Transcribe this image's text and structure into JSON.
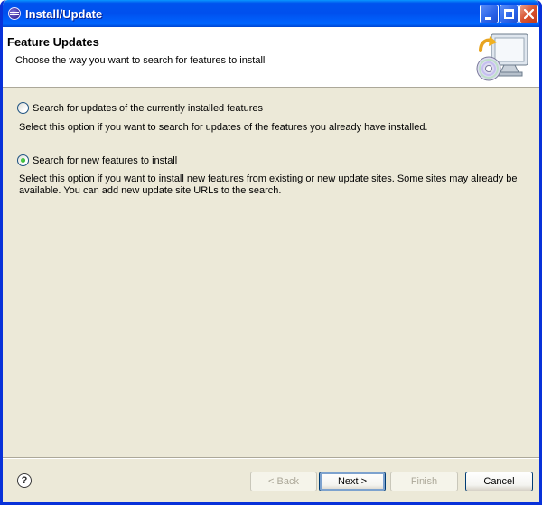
{
  "window": {
    "title": "Install/Update",
    "icon": "eclipse-icon"
  },
  "banner": {
    "title": "Feature Updates",
    "description": "Choose the way you want to search for features to install",
    "icon": "install-update-wizard-graphic"
  },
  "options": [
    {
      "label": "Search for updates of the currently installed features",
      "description": "Select this option if you want to search for updates of the features you already have installed.",
      "selected": false
    },
    {
      "label": "Search for new features to install",
      "description": "Select this option if you want to install new features from existing or new update sites. Some sites may already be available. You can add new update site URLs to the search.",
      "selected": true
    }
  ],
  "buttons": {
    "help": "?",
    "back": "< Back",
    "next": "Next >",
    "finish": "Finish",
    "cancel": "Cancel"
  },
  "colors": {
    "titlebar": "#0054e3",
    "dialog_bg": "#ece9d8",
    "banner_bg": "#ffffff"
  }
}
